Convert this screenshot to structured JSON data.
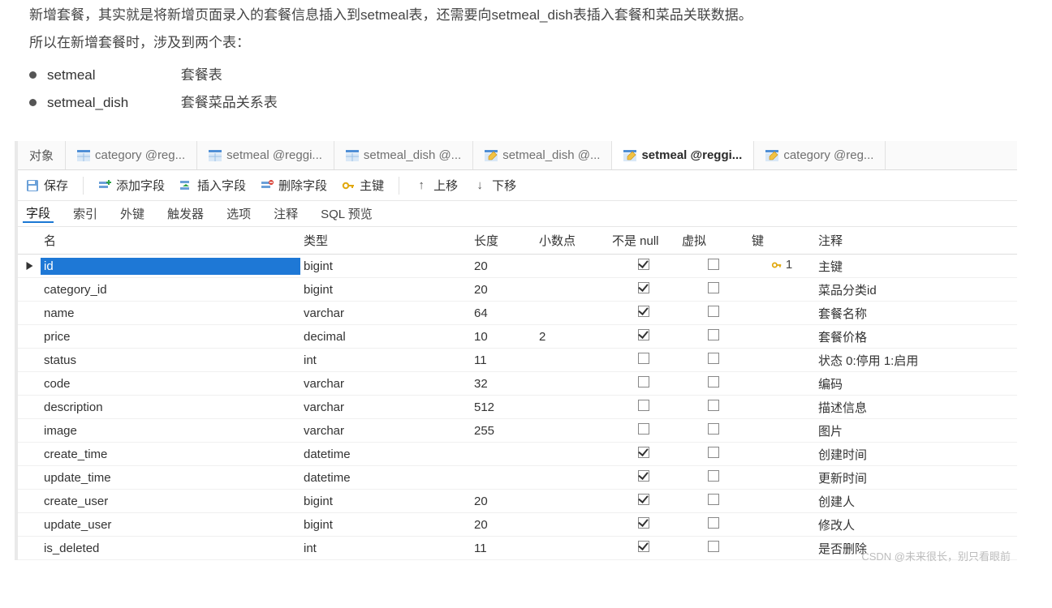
{
  "doc": {
    "line1": "新增套餐，其实就是将新增页面录入的套餐信息插入到setmeal表，还需要向setmeal_dish表插入套餐和菜品关联数据。",
    "line2": "所以在新增套餐时，涉及到两个表：",
    "bullets": [
      {
        "key": "setmeal",
        "desc": "套餐表"
      },
      {
        "key": "setmeal_dish",
        "desc": "套餐菜品关系表"
      }
    ]
  },
  "tabs": {
    "objects_label": "对象",
    "items": [
      {
        "label": "category @reg...",
        "kind": "table",
        "active": false
      },
      {
        "label": "setmeal @reggi...",
        "kind": "table",
        "active": false
      },
      {
        "label": "setmeal_dish @...",
        "kind": "table",
        "active": false
      },
      {
        "label": "setmeal_dish @...",
        "kind": "design",
        "active": false
      },
      {
        "label": "setmeal @reggi...",
        "kind": "design",
        "active": true
      },
      {
        "label": "category @reg...",
        "kind": "design",
        "active": false
      }
    ]
  },
  "toolbar": {
    "save": "保存",
    "add_field": "添加字段",
    "insert_field": "插入字段",
    "delete_field": "删除字段",
    "primary_key": "主键",
    "move_up": "上移",
    "move_down": "下移"
  },
  "sub_tabs": [
    "字段",
    "索引",
    "外键",
    "触发器",
    "选项",
    "注释",
    "SQL 预览"
  ],
  "columns": {
    "name": "名",
    "type": "类型",
    "length": "长度",
    "decimals": "小数点",
    "not_null": "不是 null",
    "virtual": "虚拟",
    "key": "键",
    "comment": "注释"
  },
  "rows": [
    {
      "name": "id",
      "type": "bigint",
      "length": "20",
      "decimals": "",
      "not_null": true,
      "virtual": false,
      "key": "1",
      "comment": "主键",
      "selected": true
    },
    {
      "name": "category_id",
      "type": "bigint",
      "length": "20",
      "decimals": "",
      "not_null": true,
      "virtual": false,
      "key": "",
      "comment": "菜品分类id"
    },
    {
      "name": "name",
      "type": "varchar",
      "length": "64",
      "decimals": "",
      "not_null": true,
      "virtual": false,
      "key": "",
      "comment": "套餐名称"
    },
    {
      "name": "price",
      "type": "decimal",
      "length": "10",
      "decimals": "2",
      "not_null": true,
      "virtual": false,
      "key": "",
      "comment": "套餐价格"
    },
    {
      "name": "status",
      "type": "int",
      "length": "11",
      "decimals": "",
      "not_null": false,
      "virtual": false,
      "key": "",
      "comment": "状态 0:停用 1:启用"
    },
    {
      "name": "code",
      "type": "varchar",
      "length": "32",
      "decimals": "",
      "not_null": false,
      "virtual": false,
      "key": "",
      "comment": "编码"
    },
    {
      "name": "description",
      "type": "varchar",
      "length": "512",
      "decimals": "",
      "not_null": false,
      "virtual": false,
      "key": "",
      "comment": "描述信息"
    },
    {
      "name": "image",
      "type": "varchar",
      "length": "255",
      "decimals": "",
      "not_null": false,
      "virtual": false,
      "key": "",
      "comment": "图片"
    },
    {
      "name": "create_time",
      "type": "datetime",
      "length": "",
      "decimals": "",
      "not_null": true,
      "virtual": false,
      "key": "",
      "comment": "创建时间"
    },
    {
      "name": "update_time",
      "type": "datetime",
      "length": "",
      "decimals": "",
      "not_null": true,
      "virtual": false,
      "key": "",
      "comment": "更新时间"
    },
    {
      "name": "create_user",
      "type": "bigint",
      "length": "20",
      "decimals": "",
      "not_null": true,
      "virtual": false,
      "key": "",
      "comment": "创建人"
    },
    {
      "name": "update_user",
      "type": "bigint",
      "length": "20",
      "decimals": "",
      "not_null": true,
      "virtual": false,
      "key": "",
      "comment": "修改人"
    },
    {
      "name": "is_deleted",
      "type": "int",
      "length": "11",
      "decimals": "",
      "not_null": true,
      "virtual": false,
      "key": "",
      "comment": "是否删除"
    }
  ],
  "watermark": "CSDN @未来很长，别只看眼前"
}
